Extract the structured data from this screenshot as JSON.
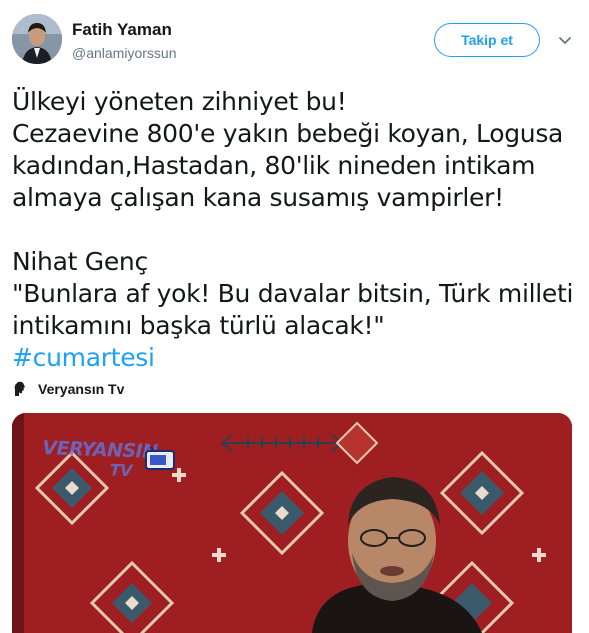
{
  "tweet": {
    "author_name": "Fatih Yaman",
    "author_handle": "@anlamiyorssun",
    "follow_label": "Takip et",
    "lines": [
      "Ülkeyi yöneten zihniyet bu!",
      "Cezaevine 800'e yakın bebeği koyan, Logusa",
      "kadından,Hastadan, 80'lik nineden intikam",
      "almaya çalışan kana susamış vampirler!",
      "",
      "Nihat Genç",
      "\"Bunlara af yok! Bu davalar bitsin, Türk milleti",
      "intikamını başka türlü alacak!\""
    ],
    "hashtag": "#cumartesi",
    "source_name": "Veryansın Tv"
  },
  "media": {
    "watermark_line1": "VERYANSIN",
    "watermark_line2": "TV"
  },
  "icons": {
    "chevron": "chevron-down-icon",
    "source": "silhouette-icon"
  },
  "colors": {
    "accent": "#1da1f2",
    "text": "#14171a",
    "secondary": "#657786",
    "carpet_red": "#9e1e22"
  }
}
